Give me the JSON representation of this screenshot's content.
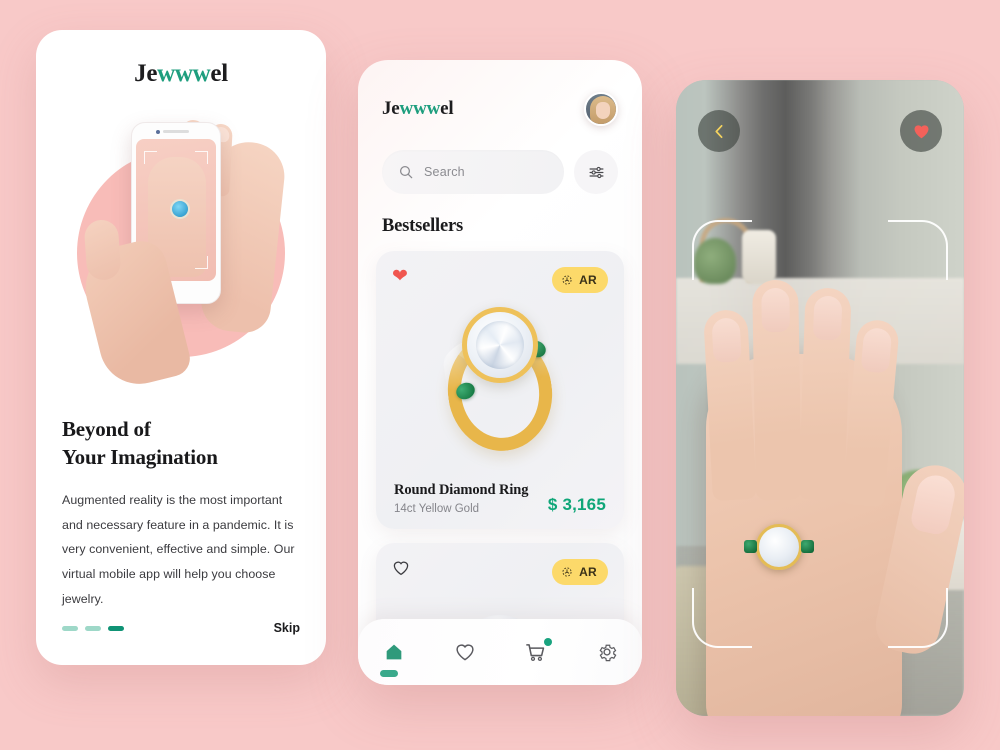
{
  "app": {
    "brand_prefix": "Je",
    "brand_middle": "www",
    "brand_suffix": "el",
    "brand_full": "Jewwwel",
    "accent_green": "#1e9e7e",
    "price_green": "#0fa678",
    "ar_yellow": "#fcd96a",
    "heart_red": "#f0564f",
    "background_pink": "#f8c9c8"
  },
  "onboarding": {
    "logo_prefix": "Je",
    "logo_middle": "www",
    "logo_suffix": "el",
    "headline_line1": "Beyond of",
    "headline_line2": "Your Imagination",
    "paragraph": "Augmented reality is the most important and necessary feature in a pandemic. It is very convenient, effective and simple. Our virtual mobile app will help you choose jewelry.",
    "skip_label": "Skip",
    "pagination": {
      "total": 3,
      "active_index": 2
    },
    "hero_icon": "hands-holding-phone-ar-ring-image"
  },
  "home": {
    "logo_prefix": "Je",
    "logo_middle": "www",
    "logo_suffix": "el",
    "avatar": "user-avatar-photo",
    "search": {
      "placeholder": "Search",
      "icon": "search-icon"
    },
    "filter_icon": "sliders-filter-icon",
    "section_title": "Bestsellers",
    "products": [
      {
        "name": "Round Diamond Ring",
        "subtitle": "14ct Yellow Gold",
        "price": "$ 3,165",
        "ar_label": "AR",
        "ar_icon": "ar-cube-icon",
        "favorited": true,
        "image": "gold-diamond-emerald-ring"
      },
      {
        "name": "",
        "subtitle": "",
        "price": "",
        "ar_label": "AR",
        "ar_icon": "ar-cube-icon",
        "favorited": false,
        "image": "diamond-ring-partial"
      }
    ],
    "nav": [
      {
        "id": "home",
        "icon": "home-icon",
        "active": true,
        "badge": false
      },
      {
        "id": "favorites",
        "icon": "heart-icon",
        "active": false,
        "badge": false
      },
      {
        "id": "cart",
        "icon": "cart-icon",
        "active": false,
        "badge": true
      },
      {
        "id": "settings",
        "icon": "gear-icon",
        "active": false,
        "badge": false
      }
    ]
  },
  "ar_view": {
    "back_icon": "chevron-left-icon",
    "like_icon": "heart-icon",
    "liked": true,
    "scan_frame": "corner-brackets-overlay",
    "scene": "hand-with-ar-ring-in-room"
  }
}
